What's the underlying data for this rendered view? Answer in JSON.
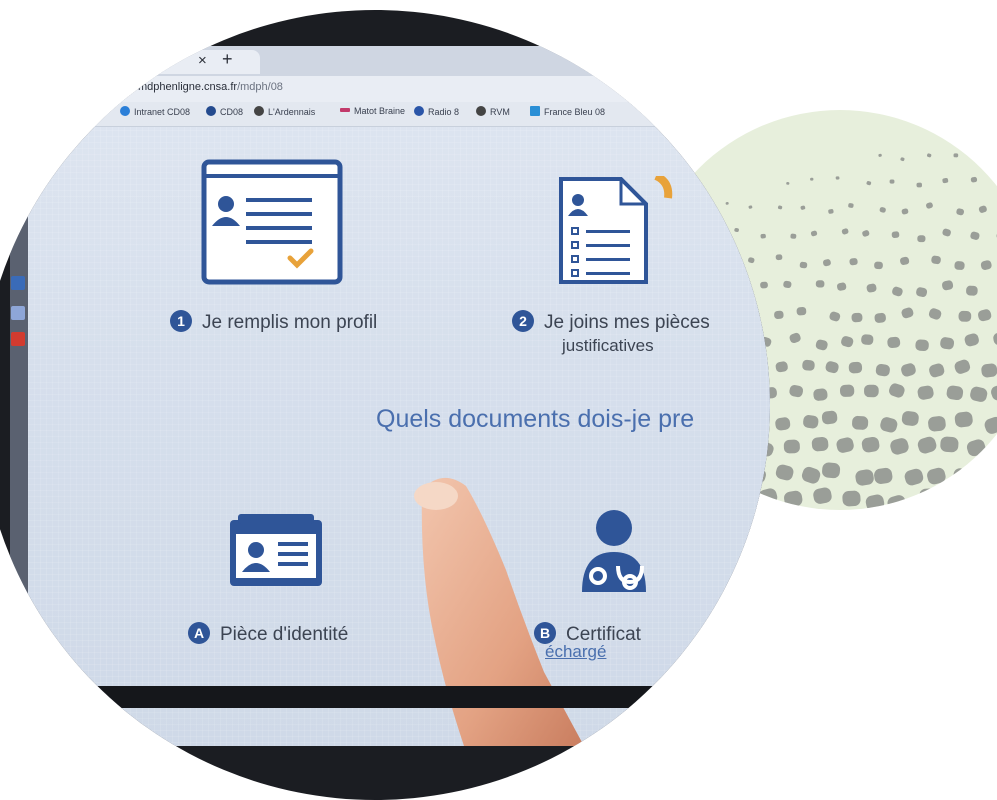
{
  "browser": {
    "tab_close": "×",
    "tab_new": "+",
    "url_domain": "mdphenligne.cnsa.fr",
    "url_path": "/mdph/08",
    "bookmarks": [
      {
        "label": "Intranet CD08",
        "color": "#2b7fd8"
      },
      {
        "label": "CD08",
        "color": "#234a8e"
      },
      {
        "label": "L'Ardennais",
        "color": "#444444"
      },
      {
        "label": "Matot Braine",
        "color": "#c23a6b"
      },
      {
        "label": "Radio 8",
        "color": "#2a55a8"
      },
      {
        "label": "RVM",
        "color": "#444444"
      },
      {
        "label": "France Bleu 08",
        "color": "#2a8fd6"
      }
    ]
  },
  "steps": [
    {
      "num": "1",
      "label": "Je remplis mon profil",
      "icon": "profile-form-icon"
    },
    {
      "num": "2",
      "label_line1": "Je joins mes pièces",
      "label_line2": "justificatives",
      "icon": "document-list-icon"
    }
  ],
  "question": "Quels documents dois-je pre",
  "documents": [
    {
      "letter": "A",
      "label": "Pièce d'identité",
      "icon": "id-card-icon"
    },
    {
      "letter": "B",
      "label": "Certificat",
      "icon": "doctor-icon",
      "link": "échargé"
    }
  ],
  "colors": {
    "icon_blue": "#2f5598",
    "accent_orange": "#e8a23a",
    "text": "#3c4452",
    "link": "#4a6fae"
  }
}
